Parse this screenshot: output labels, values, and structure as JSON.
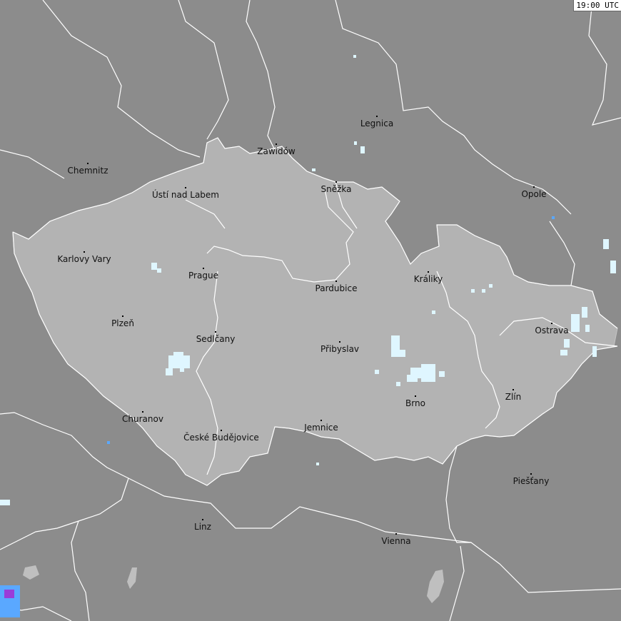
{
  "timestamp": "19:00 UTC",
  "colors": {
    "background": "#8c8c8c",
    "country_fill": "#b3b3b3",
    "border": "#ffffff",
    "lake": "#b8b8b8",
    "detection_light": "#dff6ff",
    "detection_blue": "#5aa8ff",
    "detection_purple": "#9a3cd8"
  },
  "cities": [
    {
      "id": "chemnitz",
      "name": "Chemnitz"
    },
    {
      "id": "usti",
      "name": "Ústí nad Labem"
    },
    {
      "id": "zawidow",
      "name": "Zawidów"
    },
    {
      "id": "legnica",
      "name": "Legnica"
    },
    {
      "id": "snezka",
      "name": "Sněžka"
    },
    {
      "id": "opole",
      "name": "Opole"
    },
    {
      "id": "karlovy-vary",
      "name": "Karlovy Vary"
    },
    {
      "id": "prague",
      "name": "Prague"
    },
    {
      "id": "pardubice",
      "name": "Pardubice"
    },
    {
      "id": "kraliky",
      "name": "Králiky"
    },
    {
      "id": "plzen",
      "name": "Plzeň"
    },
    {
      "id": "sedlcany",
      "name": "Sedlčany"
    },
    {
      "id": "pribyslav",
      "name": "Přibyslav"
    },
    {
      "id": "ostrava",
      "name": "Ostrava"
    },
    {
      "id": "zlin",
      "name": "Zlín"
    },
    {
      "id": "brno",
      "name": "Brno"
    },
    {
      "id": "churanov",
      "name": "Churanov"
    },
    {
      "id": "ceske-budejovice",
      "name": "České Budějovice"
    },
    {
      "id": "jemnice",
      "name": "Jemnice"
    },
    {
      "id": "piestany",
      "name": "Piešťany"
    },
    {
      "id": "linz",
      "name": "Linz"
    },
    {
      "id": "vienna",
      "name": "Vienna"
    }
  ]
}
